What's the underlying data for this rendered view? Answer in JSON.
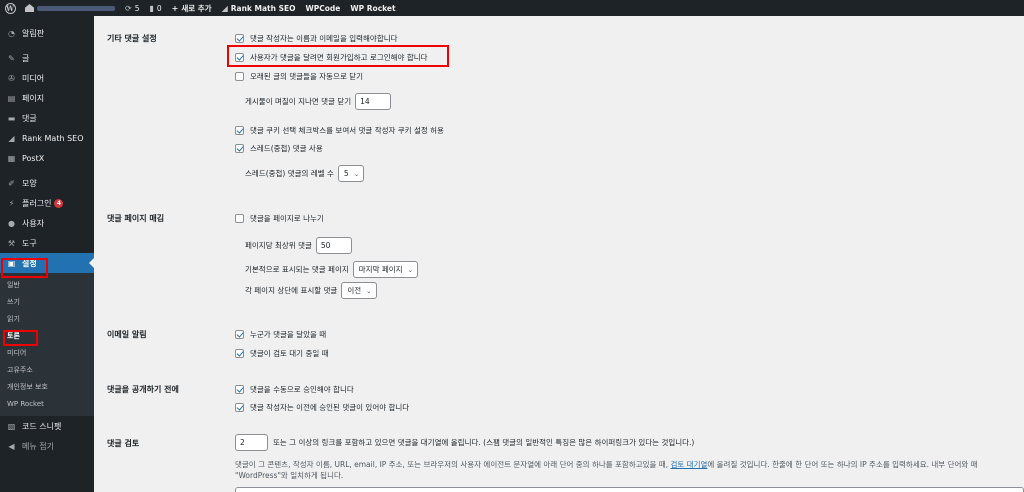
{
  "adminbar": {
    "comments_count": "5",
    "pending_count": "0",
    "new_label": "새로 추가",
    "rank_math": "Rank Math SEO",
    "wpcode": "WPCode",
    "wp_rocket": "WP Rocket"
  },
  "sidebar": {
    "items": [
      {
        "label": "알림판"
      },
      {
        "label": "글"
      },
      {
        "label": "미디어"
      },
      {
        "label": "페이지"
      },
      {
        "label": "댓글"
      },
      {
        "label": "Rank Math SEO"
      },
      {
        "label": "PostX"
      },
      {
        "label": "모양"
      },
      {
        "label": "플러그인",
        "badge": "4"
      },
      {
        "label": "사용자"
      },
      {
        "label": "도구"
      },
      {
        "label": "설정"
      },
      {
        "label": "코드 스니펫"
      },
      {
        "label": "메뉴 접기"
      }
    ],
    "submenu": [
      "일반",
      "쓰기",
      "읽기",
      "토론",
      "미디어",
      "고유주소",
      "개인정보 보호",
      "WP Rocket"
    ]
  },
  "sections": {
    "other": {
      "label": "기타 댓글 설정",
      "opt_name_email": "댓글 작성자는 이름과 이메일을 입력해야합니다",
      "opt_registration": "사용자가 댓글을 달려면 회원가입하고 로그인해야 합니다",
      "opt_close_old": "오래된 글의 댓글들을 자동으로 닫기",
      "close_days_label": "게시물이 며칠이 지나면 댓글 닫기",
      "close_days_value": "14",
      "opt_cookies": "댓글 쿠키 선택 체크박스를 보여서 댓글 작성자 쿠키 설정 허용",
      "opt_threaded": "스레드(중첩) 댓글 사용",
      "thread_depth_label": "스레드(중첩) 댓글의 레벨 수",
      "thread_depth_value": "5"
    },
    "paging": {
      "label": "댓글 페이지 매김",
      "opt_break": "댓글을 페이지로 나누기",
      "per_page_label": "페이지당 최상위 댓글",
      "per_page_value": "50",
      "default_page_label": "기본적으로 표시되는 댓글 페이지",
      "default_page_value": "마지막 페이지",
      "order_label": "각 페이지 상단에 표시할 댓글",
      "order_value": "이전"
    },
    "email": {
      "label": "이메일 알림",
      "opt_anyone": "누군가 댓글을 달았을 때",
      "opt_moderation": "댓글이 검토 대기 중일 때"
    },
    "before": {
      "label": "댓글을 공개하기 전에",
      "opt_manual": "댓글을 수동으로 승인해야 합니다",
      "opt_previously": "댓글 작성자는 이전에 승인된 댓글이 있어야 합니다"
    },
    "moderation": {
      "label": "댓글 검토",
      "links_value": "2",
      "links_text": "또는 그 이상의 링크를 포함하고 있으면 댓글을 대기열에 올립니다. (스팸 댓글의 일반적인 특징은 많은 하이퍼링크가 있다는 것입니다.)",
      "desc_before": "댓글이 그 콘텐츠, 작성자 이름, URL, email, IP 주소, 또는 브라우저의 사용자 에이전트 문자열에 아래 단어 중의 하나를 포함하고있을 때, ",
      "desc_link": "검토 대기열",
      "desc_after": "에 올려질 것입니다. 한줄에 한 단어 또는 하나의 IP 주소를 입력하세요. 내부 단어와 매",
      "desc_line2": "\"WordPress\"와 일치하게 됩니다."
    }
  }
}
